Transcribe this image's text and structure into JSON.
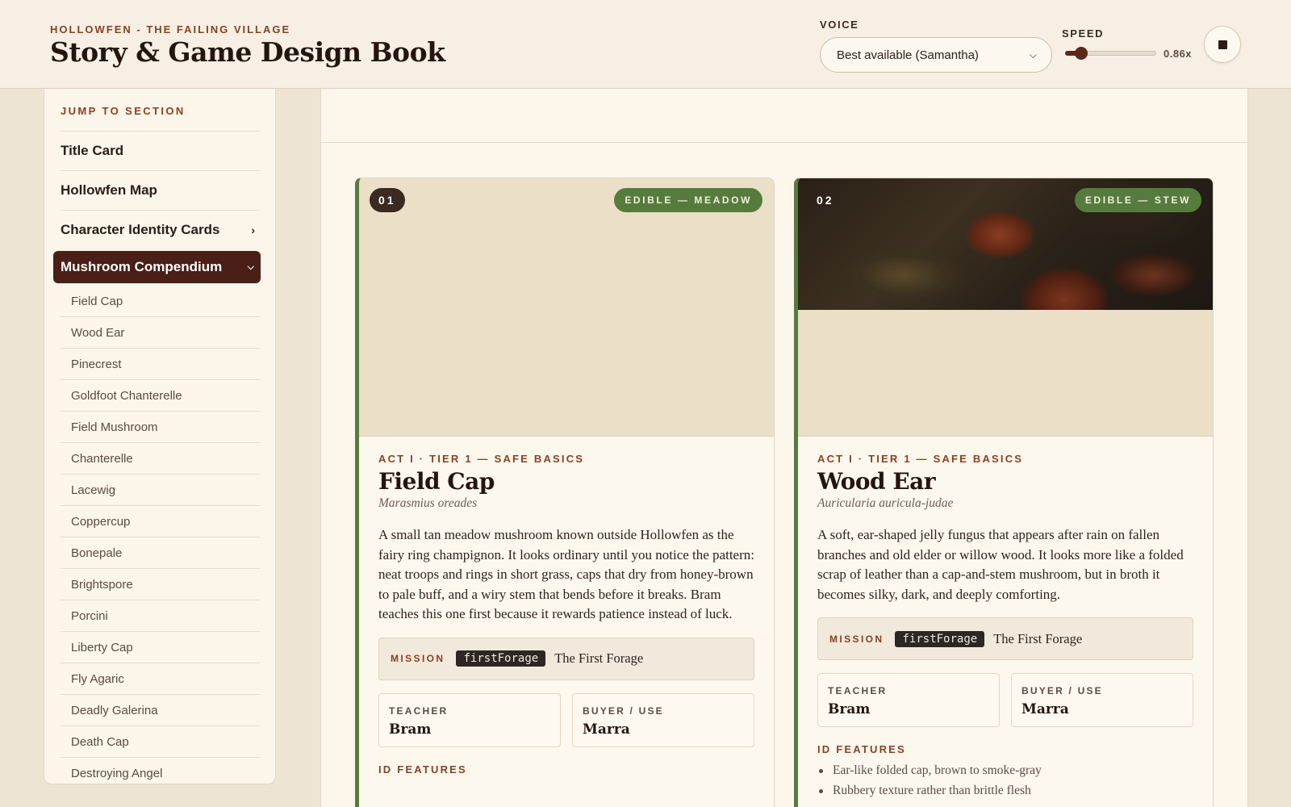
{
  "header": {
    "eyebrow": "HOLLOWFEN - THE FAILING VILLAGE",
    "title": "Story & Game Design Book",
    "voice_label": "VOICE",
    "voice_value": "Best available (Samantha)",
    "speed_label": "SPEED",
    "speed_value": "0.86x",
    "speed_fraction": 0.18,
    "stop_icon": "stop-icon"
  },
  "sidebar": {
    "heading": "JUMP TO SECTION",
    "items": [
      {
        "label": "Title Card"
      },
      {
        "label": "Hollowfen Map"
      },
      {
        "label": "Character Identity Cards",
        "chevron": "›"
      }
    ],
    "active": {
      "label": "Mushroom Compendium",
      "chevron": "⌄"
    },
    "sub_items": [
      "Field Cap",
      "Wood Ear",
      "Pinecrest",
      "Goldfoot Chanterelle",
      "Field Mushroom",
      "Chanterelle",
      "Lacewig",
      "Coppercup",
      "Bonepale",
      "Brightspore",
      "Porcini",
      "Liberty Cap",
      "Fly Agaric",
      "Deadly Galerina",
      "Death Cap",
      "Destroying Angel"
    ]
  },
  "cards": [
    {
      "number": "01",
      "tag": "EDIBLE — MEADOW",
      "tier": "ACT I · TIER 1 — SAFE BASICS",
      "name": "Field Cap",
      "latin": "Marasmius oreades",
      "description": "A small tan meadow mushroom known outside Hollowfen as the fairy ring champignon. It looks ordinary until you notice the pattern: neat troops and rings in short grass, caps that dry from honey-brown to pale buff, and a wiry stem that bends before it breaks. Bram teaches this one first because it rewards patience instead of luck.",
      "mission_label": "MISSION",
      "mission_code": "firstForage",
      "mission_name": "The First Forage",
      "teacher_label": "TEACHER",
      "teacher": "Bram",
      "buyer_label": "BUYER / USE",
      "buyer": "Marra",
      "features_label": "ID FEATURES",
      "features": []
    },
    {
      "number": "02",
      "tag": "EDIBLE — STEW",
      "tier": "ACT I · TIER 1 — SAFE BASICS",
      "name": "Wood Ear",
      "latin": "Auricularia auricula-judae",
      "description": "A soft, ear-shaped jelly fungus that appears after rain on fallen branches and old elder or willow wood. It looks more like a folded scrap of leather than a cap-and-stem mushroom, but in broth it becomes silky, dark, and deeply comforting.",
      "mission_label": "MISSION",
      "mission_code": "firstForage",
      "mission_name": "The First Forage",
      "teacher_label": "TEACHER",
      "teacher": "Bram",
      "buyer_label": "BUYER / USE",
      "buyer": "Marra",
      "features_label": "ID FEATURES",
      "features": [
        "Ear-like folded cap, brown to smoke-gray",
        "Rubbery texture rather than brittle flesh"
      ]
    }
  ]
}
